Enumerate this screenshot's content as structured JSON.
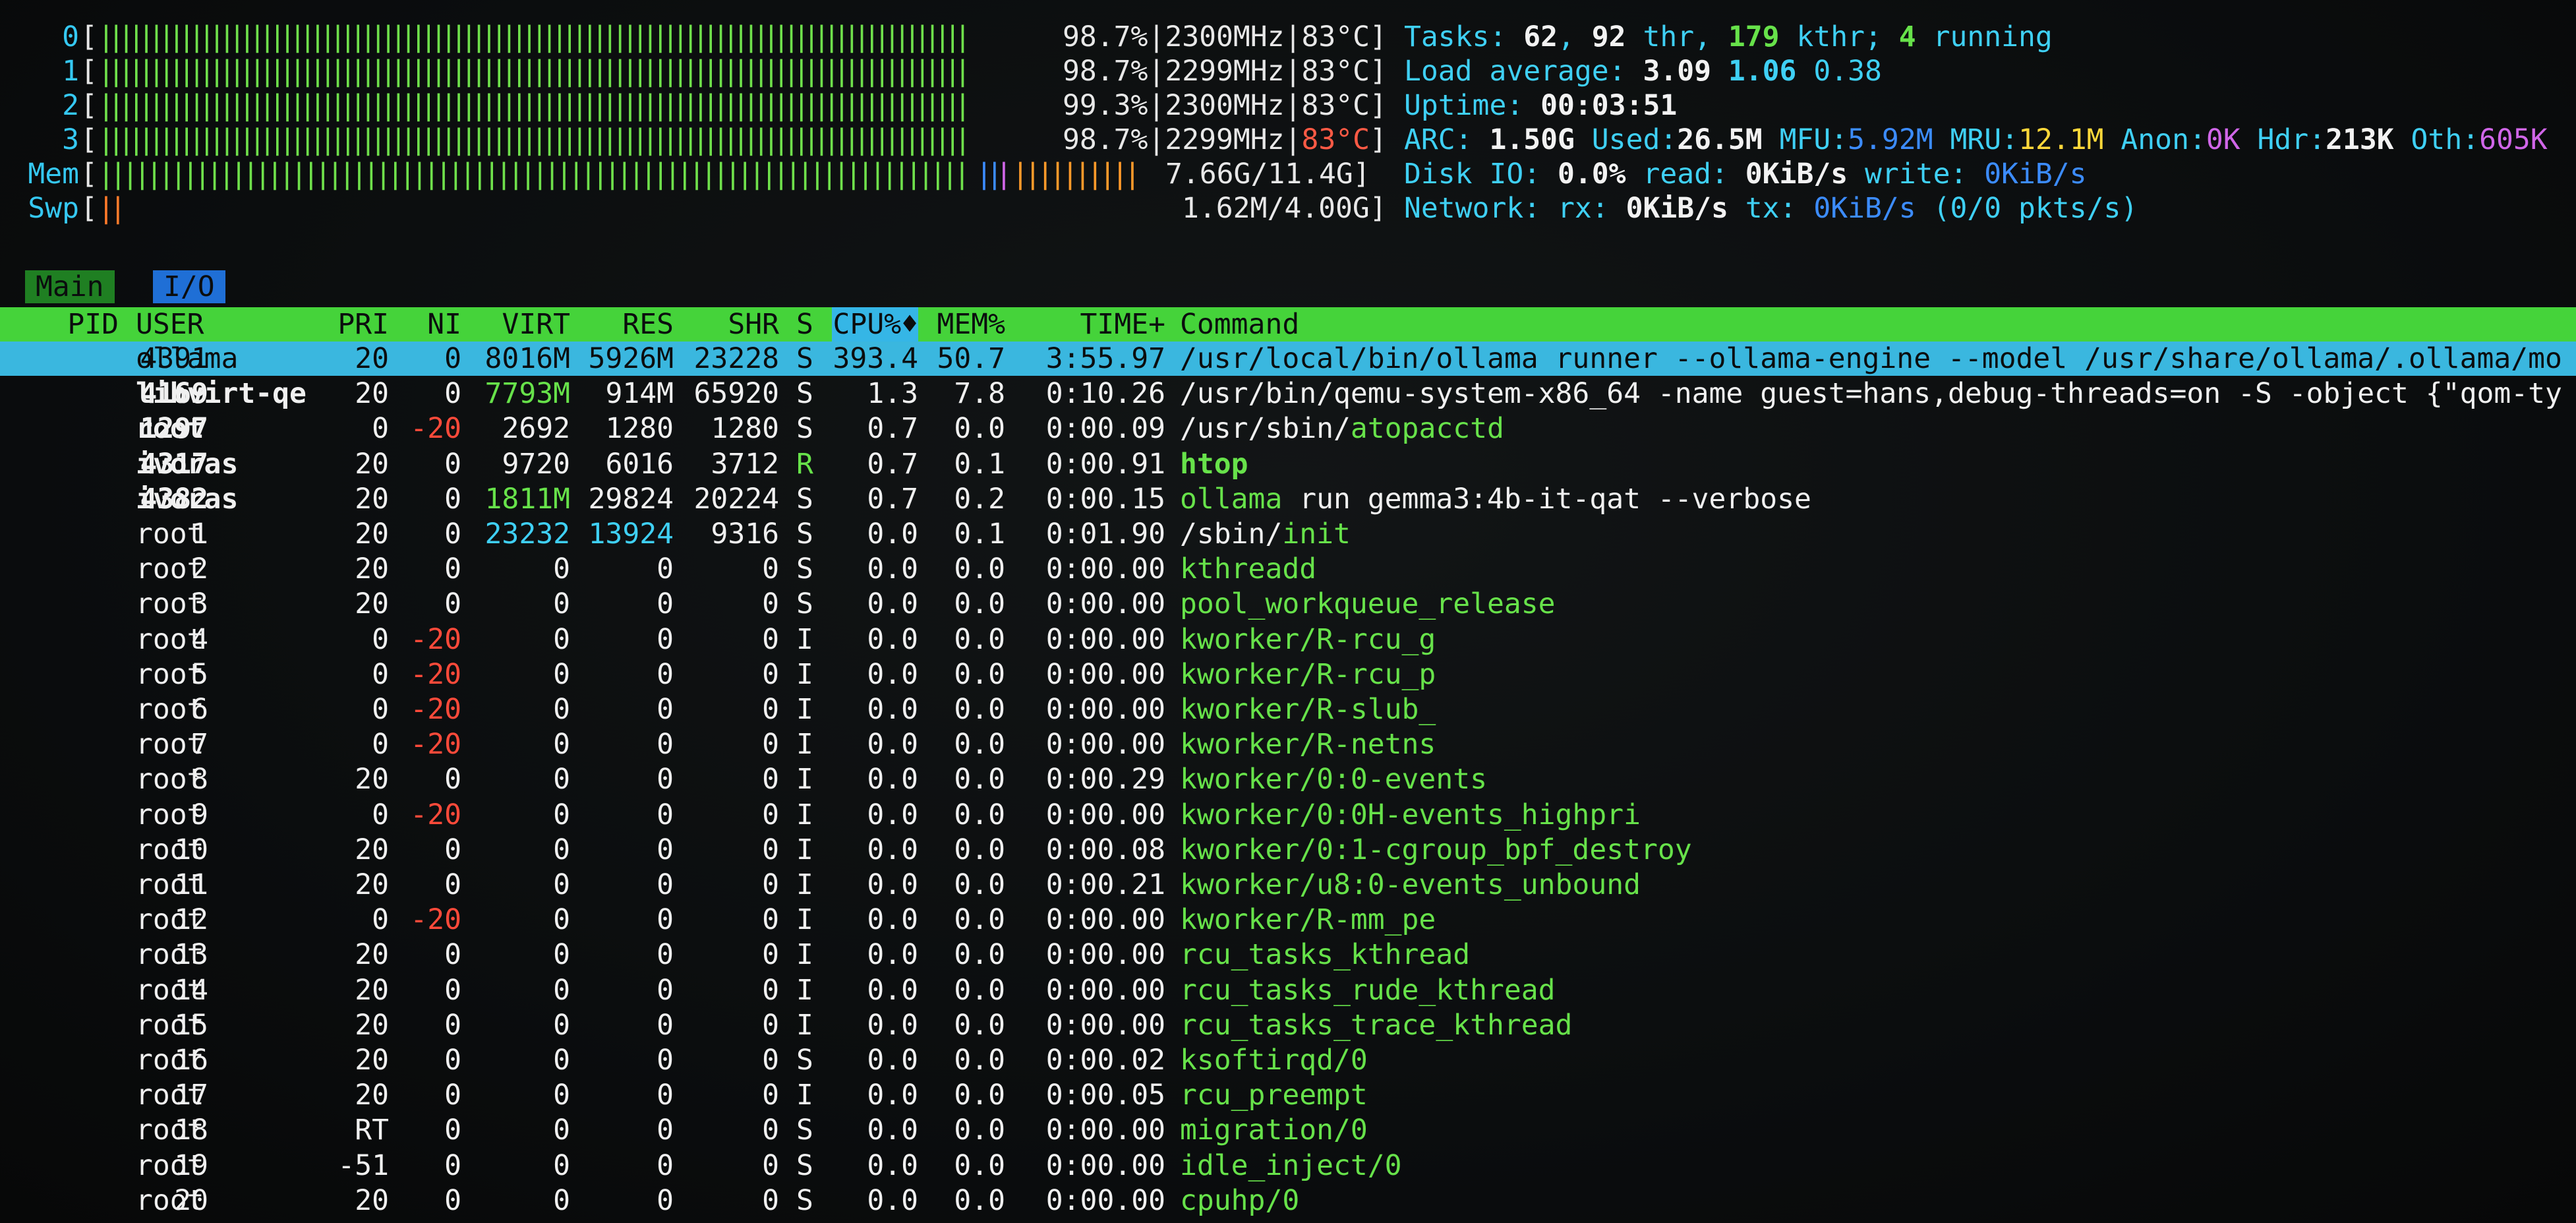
{
  "meters": {
    "cpus": [
      {
        "label": "0",
        "bar": "||||||||||||||||||||||||||||||||||||||||||||||||||||||||||||||||||||||||||||||||||||||",
        "percent": "98.7%",
        "freq": "2300MHz",
        "temp": "83°C"
      },
      {
        "label": "1",
        "bar": "||||||||||||||||||||||||||||||||||||||||||||||||||||||||||||||||||||||||||||||||||||||",
        "percent": "98.7%",
        "freq": "2299MHz",
        "temp": "83°C"
      },
      {
        "label": "2",
        "bar": "||||||||||||||||||||||||||||||||||||||||||||||||||||||||||||||||||||||||||||||||||||||",
        "percent": "99.3%",
        "freq": "2300MHz",
        "temp": "83°C"
      },
      {
        "label": "3",
        "bar": "||||||||||||||||||||||||||||||||||||||||||||||||||||||||||||||||||||||||||||||||||||||",
        "percent": "98.7%",
        "freq": "2299MHz",
        "temp": "83°C"
      }
    ],
    "mem": {
      "label": "Mem",
      "bar_green": "||||||||||||||||||||||||||||||||||||||||||||||||||||||||||||||||||||||||",
      "bar_blue": "||",
      "bar_magenta": "|",
      "bar_orange": "||||||||||",
      "value": "7.66G/11.4G"
    },
    "swp": {
      "label": "Swp",
      "bar_red": "||",
      "value": "1.62M/4.00G"
    }
  },
  "info": {
    "tasks": {
      "label": "Tasks: ",
      "count": "62",
      "sep1": ", ",
      "thr": "92",
      "thr_label": " thr, ",
      "kthr": "179",
      "kthr_label": " kthr; ",
      "running": "4",
      "running_label": " running"
    },
    "load": {
      "label": "Load average: ",
      "v1": "3.09",
      "v2": "1.06",
      "v3": "0.38"
    },
    "uptime": {
      "label": "Uptime: ",
      "value": "00:03:51"
    },
    "arc": {
      "label": "ARC: ",
      "arc": "1.50G",
      "used_label": " Used:",
      "used": "26.5M",
      "mfu_label": " MFU:",
      "mfu": "5.92M",
      "mru_label": " MRU:",
      "mru": "12.1M",
      "anon_label": " Anon:",
      "anon": "0K",
      "hdr_label": " Hdr:",
      "hdr": "213K",
      "oth_label": " Oth:",
      "oth": "605K"
    },
    "disk": {
      "label": "Disk IO: ",
      "pct": "0.0%",
      "read_label": " read: ",
      "read": "0KiB/s",
      "write_label": " write: ",
      "write": "0KiB/s"
    },
    "network": {
      "label": "Network: ",
      "rx_label": "rx: ",
      "rx": "0KiB/s",
      "tx_label": " tx: ",
      "tx": "0KiB/s",
      "pkts": " (0/0 pkts/s)"
    }
  },
  "tabs": {
    "main": "Main",
    "io": "I/O"
  },
  "header": {
    "pid": "PID",
    "user": "USER",
    "pri": "PRI",
    "ni": "NI",
    "virt": "VIRT",
    "res": "RES",
    "shr": "SHR",
    "s": "S",
    "cpu": "CPU%",
    "sort_arrow": "♦",
    "mem": "MEM%",
    "time": "TIME+",
    "command": "Command"
  },
  "processes": [
    {
      "pid": "4391",
      "user": "ollama",
      "pri": "20",
      "ni": "0",
      "virt": "8016M",
      "res": "5926M",
      "shr": "23228",
      "s": "S",
      "cpu": "393.4",
      "mem": "50.7",
      "time": "3:55.97",
      "cmd": "/usr/local/bin/ollama runner --ollama-engine --model /usr/share/ollama/.ollama/mo",
      "cmd_hl": ""
    },
    {
      "pid": "4169",
      "user": "libvirt-qe",
      "pri": "20",
      "ni": "0",
      "virt": "7793M",
      "res": "914M",
      "shr": "65920",
      "s": "S",
      "cpu": "1.3",
      "mem": "7.8",
      "time": "0:10.26",
      "cmd": "/usr/bin/qemu-system-x86_64 -name guest=hans,debug-threads=on -S -object {\"qom-ty",
      "cmd_hl": ""
    },
    {
      "pid": "1297",
      "user": "root",
      "pri": "0",
      "ni": "-20",
      "virt": "2692",
      "res": "1280",
      "shr": "1280",
      "s": "S",
      "cpu": "0.7",
      "mem": "0.0",
      "time": "0:00.09",
      "cmd": "/usr/sbin/",
      "cmd_hl": "atopacctd"
    },
    {
      "pid": "4317",
      "user": "ivoras",
      "pri": "20",
      "ni": "0",
      "virt": "9720",
      "res": "6016",
      "shr": "3712",
      "s": "R",
      "cpu": "0.7",
      "mem": "0.1",
      "time": "0:00.91",
      "cmd": "",
      "cmd_hl": "htop"
    },
    {
      "pid": "4382",
      "user": "ivoras",
      "pri": "20",
      "ni": "0",
      "virt": "1811M",
      "res": "29824",
      "shr": "20224",
      "s": "S",
      "cpu": "0.7",
      "mem": "0.2",
      "time": "0:00.15",
      "cmd": " run gemma3:4b-it-qat --verbose",
      "cmd_hl": "ollama"
    },
    {
      "pid": "1",
      "user": "root",
      "pri": "20",
      "ni": "0",
      "virt": "23232",
      "res": "13924",
      "shr": "9316",
      "s": "S",
      "cpu": "0.0",
      "mem": "0.1",
      "time": "0:01.90",
      "cmd": "/sbin/",
      "cmd_hl": "init"
    },
    {
      "pid": "2",
      "user": "root",
      "pri": "20",
      "ni": "0",
      "virt": "0",
      "res": "0",
      "shr": "0",
      "s": "S",
      "cpu": "0.0",
      "mem": "0.0",
      "time": "0:00.00",
      "kernel": "kthreadd"
    },
    {
      "pid": "3",
      "user": "root",
      "pri": "20",
      "ni": "0",
      "virt": "0",
      "res": "0",
      "shr": "0",
      "s": "S",
      "cpu": "0.0",
      "mem": "0.0",
      "time": "0:00.00",
      "kernel": "pool_workqueue_release"
    },
    {
      "pid": "4",
      "user": "root",
      "pri": "0",
      "ni": "-20",
      "virt": "0",
      "res": "0",
      "shr": "0",
      "s": "I",
      "cpu": "0.0",
      "mem": "0.0",
      "time": "0:00.00",
      "kernel": "kworker/R-rcu_g"
    },
    {
      "pid": "5",
      "user": "root",
      "pri": "0",
      "ni": "-20",
      "virt": "0",
      "res": "0",
      "shr": "0",
      "s": "I",
      "cpu": "0.0",
      "mem": "0.0",
      "time": "0:00.00",
      "kernel": "kworker/R-rcu_p"
    },
    {
      "pid": "6",
      "user": "root",
      "pri": "0",
      "ni": "-20",
      "virt": "0",
      "res": "0",
      "shr": "0",
      "s": "I",
      "cpu": "0.0",
      "mem": "0.0",
      "time": "0:00.00",
      "kernel": "kworker/R-slub_"
    },
    {
      "pid": "7",
      "user": "root",
      "pri": "0",
      "ni": "-20",
      "virt": "0",
      "res": "0",
      "shr": "0",
      "s": "I",
      "cpu": "0.0",
      "mem": "0.0",
      "time": "0:00.00",
      "kernel": "kworker/R-netns"
    },
    {
      "pid": "8",
      "user": "root",
      "pri": "20",
      "ni": "0",
      "virt": "0",
      "res": "0",
      "shr": "0",
      "s": "I",
      "cpu": "0.0",
      "mem": "0.0",
      "time": "0:00.29",
      "kernel": "kworker/0:0-events"
    },
    {
      "pid": "9",
      "user": "root",
      "pri": "0",
      "ni": "-20",
      "virt": "0",
      "res": "0",
      "shr": "0",
      "s": "I",
      "cpu": "0.0",
      "mem": "0.0",
      "time": "0:00.00",
      "kernel": "kworker/0:0H-events_highpri"
    },
    {
      "pid": "10",
      "user": "root",
      "pri": "20",
      "ni": "0",
      "virt": "0",
      "res": "0",
      "shr": "0",
      "s": "I",
      "cpu": "0.0",
      "mem": "0.0",
      "time": "0:00.08",
      "kernel": "kworker/0:1-cgroup_bpf_destroy"
    },
    {
      "pid": "11",
      "user": "root",
      "pri": "20",
      "ni": "0",
      "virt": "0",
      "res": "0",
      "shr": "0",
      "s": "I",
      "cpu": "0.0",
      "mem": "0.0",
      "time": "0:00.21",
      "kernel": "kworker/u8:0-events_unbound"
    },
    {
      "pid": "12",
      "user": "root",
      "pri": "0",
      "ni": "-20",
      "virt": "0",
      "res": "0",
      "shr": "0",
      "s": "I",
      "cpu": "0.0",
      "mem": "0.0",
      "time": "0:00.00",
      "kernel": "kworker/R-mm_pe"
    },
    {
      "pid": "13",
      "user": "root",
      "pri": "20",
      "ni": "0",
      "virt": "0",
      "res": "0",
      "shr": "0",
      "s": "I",
      "cpu": "0.0",
      "mem": "0.0",
      "time": "0:00.00",
      "kernel": "rcu_tasks_kthread"
    },
    {
      "pid": "14",
      "user": "root",
      "pri": "20",
      "ni": "0",
      "virt": "0",
      "res": "0",
      "shr": "0",
      "s": "I",
      "cpu": "0.0",
      "mem": "0.0",
      "time": "0:00.00",
      "kernel": "rcu_tasks_rude_kthread"
    },
    {
      "pid": "15",
      "user": "root",
      "pri": "20",
      "ni": "0",
      "virt": "0",
      "res": "0",
      "shr": "0",
      "s": "I",
      "cpu": "0.0",
      "mem": "0.0",
      "time": "0:00.00",
      "kernel": "rcu_tasks_trace_kthread"
    },
    {
      "pid": "16",
      "user": "root",
      "pri": "20",
      "ni": "0",
      "virt": "0",
      "res": "0",
      "shr": "0",
      "s": "S",
      "cpu": "0.0",
      "mem": "0.0",
      "time": "0:00.02",
      "kernel": "ksoftirqd/0"
    },
    {
      "pid": "17",
      "user": "root",
      "pri": "20",
      "ni": "0",
      "virt": "0",
      "res": "0",
      "shr": "0",
      "s": "I",
      "cpu": "0.0",
      "mem": "0.0",
      "time": "0:00.05",
      "kernel": "rcu_preempt"
    },
    {
      "pid": "18",
      "user": "root",
      "pri": "RT",
      "ni": "0",
      "virt": "0",
      "res": "0",
      "shr": "0",
      "s": "S",
      "cpu": "0.0",
      "mem": "0.0",
      "time": "0:00.00",
      "kernel": "migration/0"
    },
    {
      "pid": "19",
      "user": "root",
      "pri": "-51",
      "ni": "0",
      "virt": "0",
      "res": "0",
      "shr": "0",
      "s": "S",
      "cpu": "0.0",
      "mem": "0.0",
      "time": "0:00.00",
      "kernel": "idle_inject/0"
    },
    {
      "pid": "20",
      "user": "root",
      "pri": "20",
      "ni": "0",
      "virt": "0",
      "res": "0",
      "shr": "0",
      "s": "S",
      "cpu": "0.0",
      "mem": "0.0",
      "time": "0:00.00",
      "kernel": "cpuhp/0"
    }
  ],
  "colors": {
    "background": "#0b0d0e",
    "header_bg": "#45d33a",
    "selected_bg": "#3ab7df",
    "label_cyan": "#3fd0f5",
    "bar_green": "#6fe04b",
    "warn_red": "#ff4a3a"
  }
}
